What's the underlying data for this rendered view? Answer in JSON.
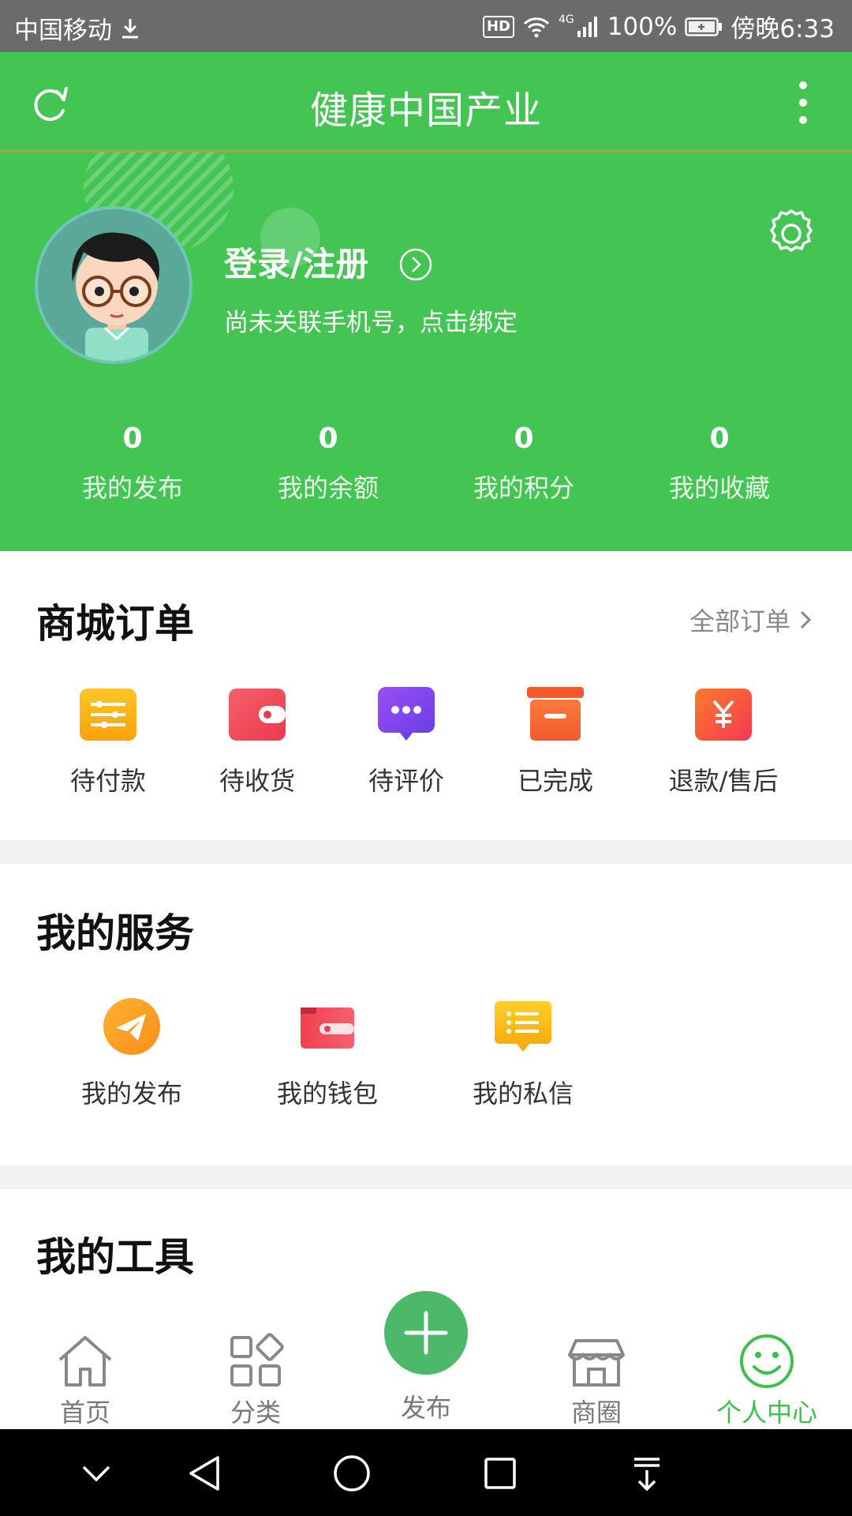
{
  "status_bar": {
    "carrier": "中国移动",
    "network": "4G",
    "hd": "HD",
    "battery": "100%",
    "time": "傍晚6:33"
  },
  "header": {
    "title": "健康中国产业"
  },
  "profile": {
    "login_label": "登录/注册",
    "bind_tip": "尚未关联手机号，点击绑定",
    "stats": [
      {
        "value": "0",
        "label": "我的发布"
      },
      {
        "value": "0",
        "label": "我的余额"
      },
      {
        "value": "0",
        "label": "我的积分"
      },
      {
        "value": "0",
        "label": "我的收藏"
      }
    ]
  },
  "orders": {
    "title": "商城订单",
    "all_label": "全部订单",
    "items": [
      {
        "label": "待付款",
        "icon": "pending-payment-icon",
        "color": "#fbb416"
      },
      {
        "label": "待收货",
        "icon": "pending-receipt-icon",
        "color": "#f04e5e"
      },
      {
        "label": "待评价",
        "icon": "pending-review-icon",
        "color": "#7b4cf0"
      },
      {
        "label": "已完成",
        "icon": "completed-box-icon",
        "color": "#fb6a3a"
      },
      {
        "label": "退款/售后",
        "icon": "refund-icon",
        "color": "#fb4a4a"
      }
    ]
  },
  "services": {
    "title": "我的服务",
    "items": [
      {
        "label": "我的发布",
        "icon": "paper-plane-icon",
        "color": "#fba42b"
      },
      {
        "label": "我的钱包",
        "icon": "wallet-icon",
        "color": "#ef4a57"
      },
      {
        "label": "我的私信",
        "icon": "message-icon",
        "color": "#fbbd16"
      }
    ]
  },
  "tools": {
    "title": "我的工具"
  },
  "tabbar": {
    "tabs": [
      {
        "label": "首页",
        "icon": "home-icon"
      },
      {
        "label": "分类",
        "icon": "category-icon"
      },
      {
        "label": "发布",
        "icon": "plus-icon"
      },
      {
        "label": "商圈",
        "icon": "store-icon"
      },
      {
        "label": "个人中心",
        "icon": "smile-icon"
      }
    ],
    "active_color": "#3fbf4c"
  },
  "colors": {
    "brand_green": "#43c453"
  }
}
